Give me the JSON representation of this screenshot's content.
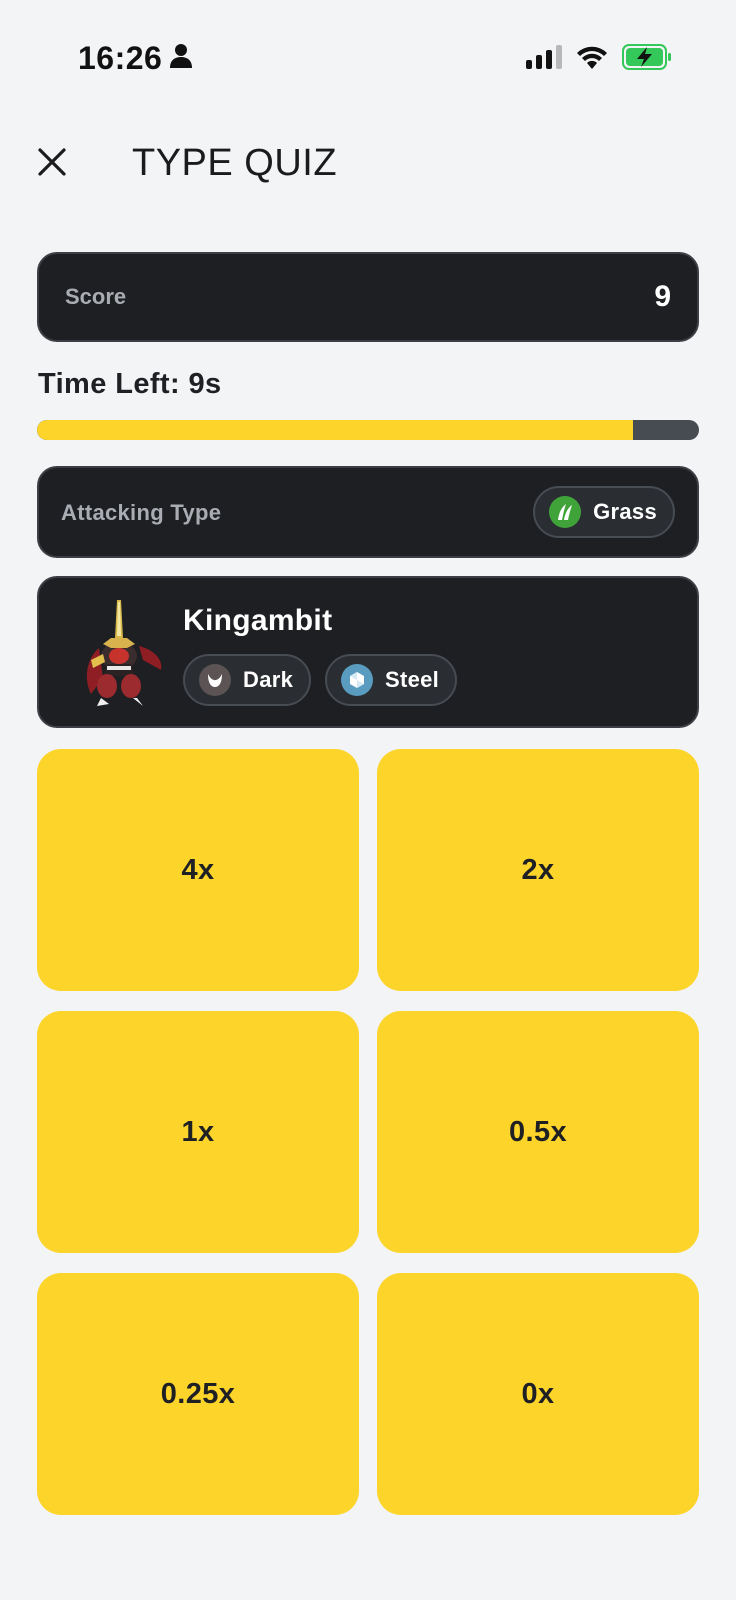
{
  "status_bar": {
    "time": "16:26",
    "icons": [
      "person-icon",
      "signal-icon",
      "wifi-icon",
      "battery-charging-icon"
    ],
    "battery_color": "#34c759"
  },
  "header": {
    "close_icon": "close-icon",
    "title": "TYPE QUIZ"
  },
  "score": {
    "label": "Score",
    "value": "9"
  },
  "timer": {
    "label": "Time Left: 9s",
    "progress": 0.9,
    "fill_color": "#fdd42a",
    "track_color": "#474b52"
  },
  "attacking_type": {
    "label": "Attacking Type",
    "type": {
      "name": "Grass",
      "icon": "grass-icon",
      "color": "#3fa33a"
    }
  },
  "defender": {
    "name": "Kingambit",
    "sprite": "kingambit-sprite",
    "types": [
      {
        "name": "Dark",
        "icon": "dark-icon",
        "color": "#5b5354"
      },
      {
        "name": "Steel",
        "icon": "steel-icon",
        "color": "#5a9cc0"
      }
    ]
  },
  "answers": [
    "4x",
    "2x",
    "1x",
    "0.5x",
    "0.25x",
    "0x"
  ],
  "colors": {
    "background": "#f3f4f6",
    "card": "#1d1f22",
    "accent": "#fdd42a"
  }
}
